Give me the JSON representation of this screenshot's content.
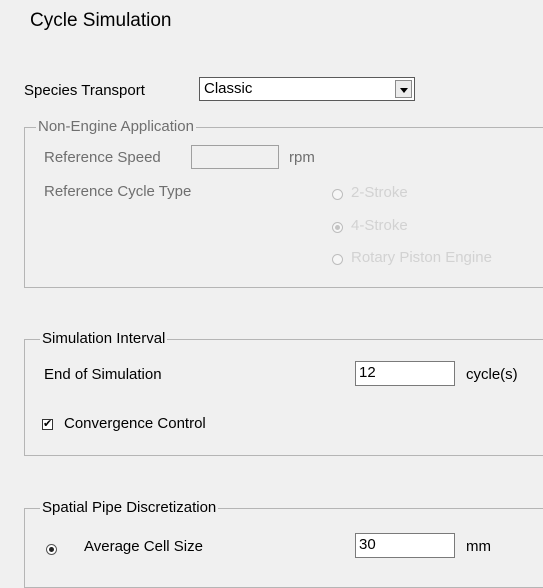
{
  "title": "Cycle Simulation",
  "species_transport": {
    "label": "Species Transport",
    "value": "Classic"
  },
  "non_engine": {
    "legend": "Non-Engine Application",
    "reference_speed_label": "Reference Speed",
    "reference_speed_value": "",
    "reference_speed_unit": "rpm",
    "cycle_type_label": "Reference Cycle Type",
    "cycle_options": [
      "2-Stroke",
      "4-Stroke",
      "Rotary Piston Engine"
    ],
    "cycle_selected": "4-Stroke"
  },
  "simulation_interval": {
    "legend": "Simulation Interval",
    "end_label": "End of Simulation",
    "end_value": "12",
    "end_unit": "cycle(s)",
    "convergence_label": "Convergence Control",
    "convergence_checked": true
  },
  "spatial": {
    "legend": "Spatial Pipe Discretization",
    "avg_cell_label": "Average Cell Size",
    "avg_cell_value": "30",
    "avg_cell_unit": "mm",
    "avg_cell_selected": true
  },
  "icons": {
    "dropdown": "chevron-down-icon",
    "check": "checkmark-icon"
  }
}
